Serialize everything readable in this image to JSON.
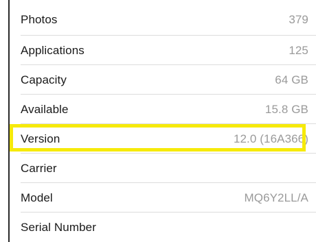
{
  "accent": {
    "highlight_color": "#f6ea0a"
  },
  "rows": [
    {
      "label": "Photos",
      "value": "379"
    },
    {
      "label": "Applications",
      "value": "125"
    },
    {
      "label": "Capacity",
      "value": "64 GB"
    },
    {
      "label": "Available",
      "value": "15.8 GB"
    },
    {
      "label": "Version",
      "value": "12.0 (16A366)"
    },
    {
      "label": "Carrier",
      "value": ""
    },
    {
      "label": "Model",
      "value": "MQ6Y2LL/A"
    },
    {
      "label": "Serial Number",
      "value": ""
    }
  ]
}
